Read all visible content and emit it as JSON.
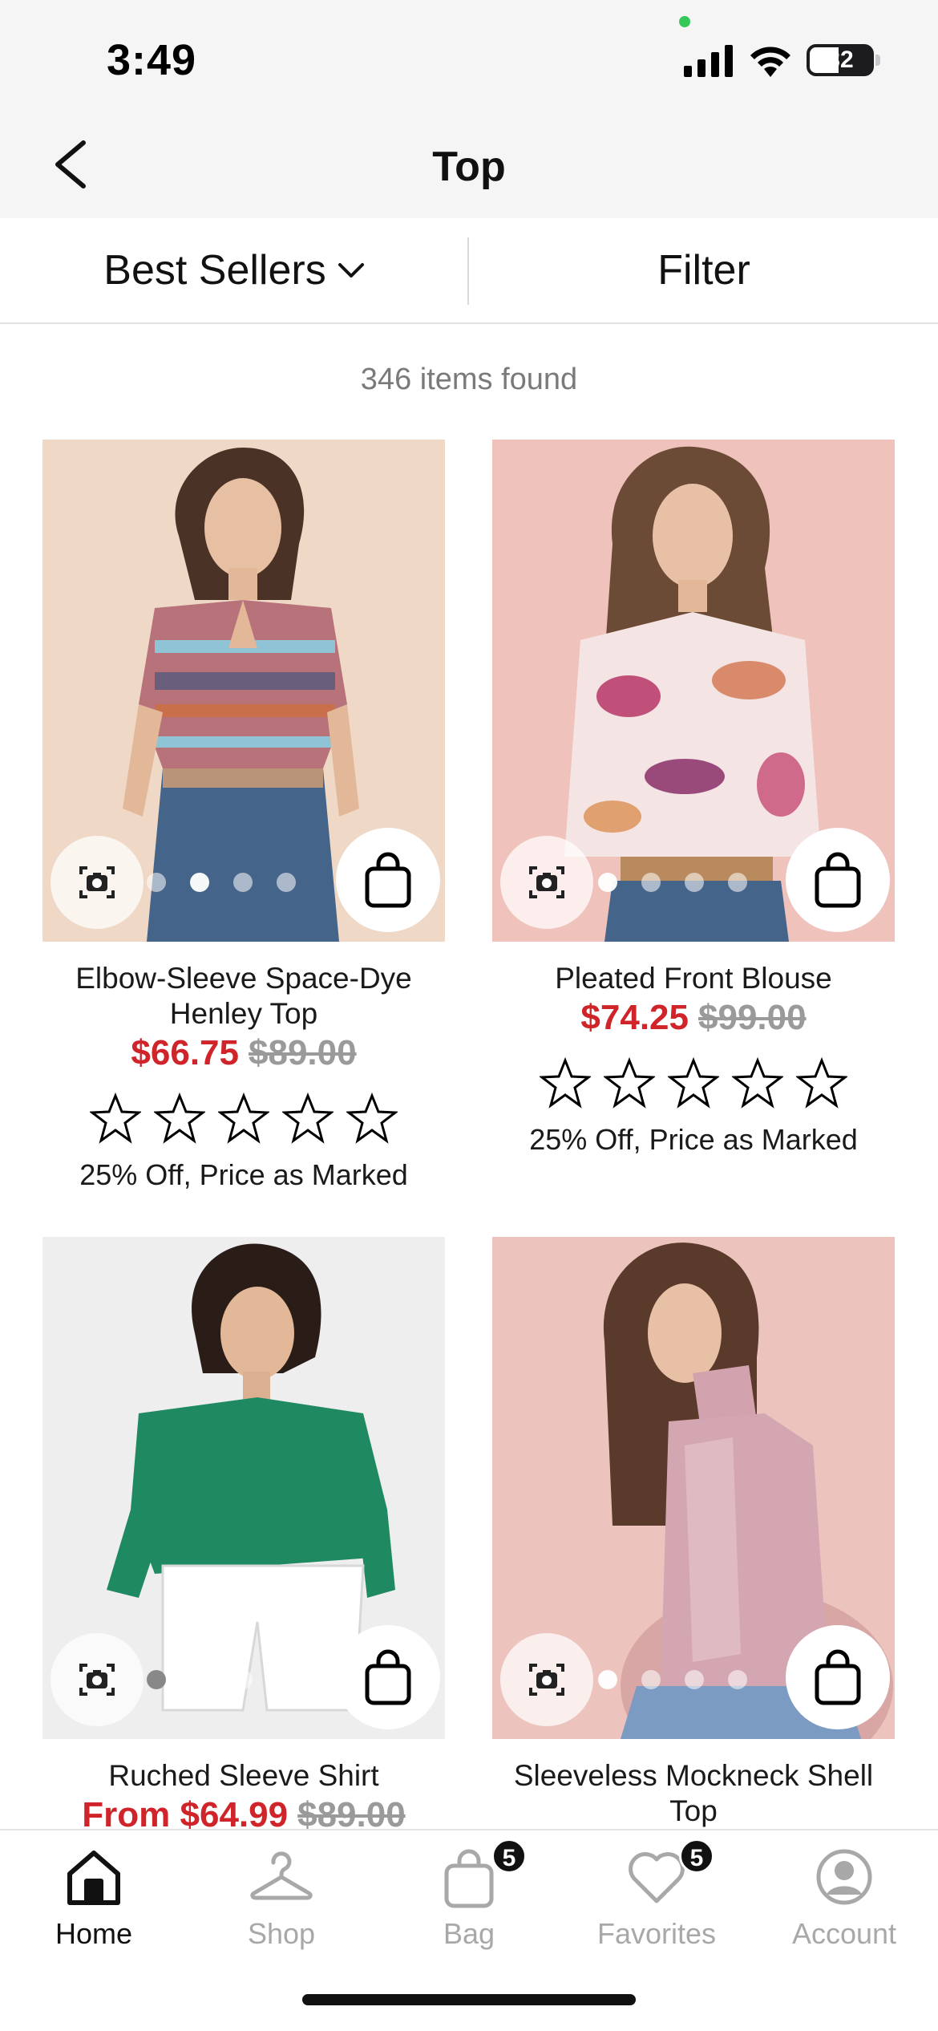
{
  "status_bar": {
    "time": "3:49",
    "battery": "32"
  },
  "header": {
    "title": "Top"
  },
  "toolbar": {
    "sort_label": "Best Sellers",
    "filter_label": "Filter"
  },
  "results": {
    "count_text": "346 items found"
  },
  "products": [
    {
      "name": "Elbow-Sleeve Space-Dye Henley Top",
      "sale_price": "$66.75",
      "original_price": "$89.00",
      "rating": 0,
      "promo": "25% Off, Price as Marked",
      "image_colors": {
        "bg": "#efd9c6"
      }
    },
    {
      "name": "Pleated Front Blouse",
      "sale_price": "$74.25",
      "original_price": "$99.00",
      "rating": 0,
      "promo": "25% Off, Price as Marked",
      "image_colors": {
        "bg": "#efc2bb"
      }
    },
    {
      "name": "Ruched Sleeve Shirt",
      "sale_price": "From $64.99",
      "original_price": "$89.00",
      "image_colors": {
        "bg": "#eeeeee"
      }
    },
    {
      "name": "Sleeveless Mockneck Shell Top",
      "image_colors": {
        "bg": "#ecc4bd"
      }
    }
  ],
  "tab_bar": {
    "tabs": [
      {
        "label": "Home",
        "icon": "home-icon",
        "active": true
      },
      {
        "label": "Shop",
        "icon": "hanger-icon"
      },
      {
        "label": "Bag",
        "icon": "bag-icon",
        "badge": "5"
      },
      {
        "label": "Favorites",
        "icon": "heart-icon",
        "badge": "5"
      },
      {
        "label": "Account",
        "icon": "account-icon"
      }
    ]
  },
  "colors": {
    "sale": "#d0242b",
    "muted": "#9a9a9a",
    "text": "#111111"
  }
}
